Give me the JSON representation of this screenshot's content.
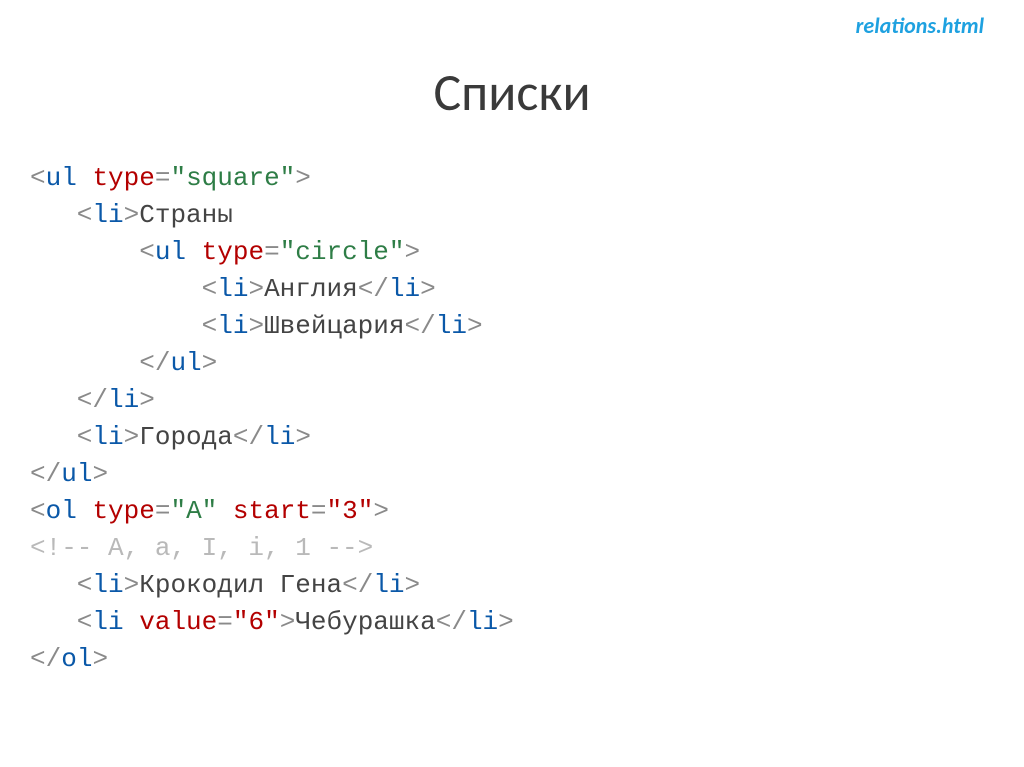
{
  "header": {
    "filelink": "relations.html",
    "title": "Списки"
  },
  "code": {
    "lines": [
      [
        {
          "cls": "p",
          "t": "<"
        },
        {
          "cls": "t",
          "t": "ul"
        },
        {
          "cls": "p",
          "t": " "
        },
        {
          "cls": "a",
          "t": "type"
        },
        {
          "cls": "p",
          "t": "="
        },
        {
          "cls": "v",
          "t": "\"square\""
        },
        {
          "cls": "p",
          "t": ">"
        }
      ],
      [
        {
          "cls": "p",
          "t": "   <"
        },
        {
          "cls": "t",
          "t": "li"
        },
        {
          "cls": "p",
          "t": ">"
        },
        {
          "cls": "tx",
          "t": "Страны"
        }
      ],
      [
        {
          "cls": "p",
          "t": "       <"
        },
        {
          "cls": "t",
          "t": "ul"
        },
        {
          "cls": "p",
          "t": " "
        },
        {
          "cls": "a",
          "t": "type"
        },
        {
          "cls": "p",
          "t": "="
        },
        {
          "cls": "v",
          "t": "\"circle\""
        },
        {
          "cls": "p",
          "t": ">"
        }
      ],
      [
        {
          "cls": "p",
          "t": "           <"
        },
        {
          "cls": "t",
          "t": "li"
        },
        {
          "cls": "p",
          "t": ">"
        },
        {
          "cls": "tx",
          "t": "Англия"
        },
        {
          "cls": "p",
          "t": "</"
        },
        {
          "cls": "t",
          "t": "li"
        },
        {
          "cls": "p",
          "t": ">"
        }
      ],
      [
        {
          "cls": "p",
          "t": "           <"
        },
        {
          "cls": "t",
          "t": "li"
        },
        {
          "cls": "p",
          "t": ">"
        },
        {
          "cls": "tx",
          "t": "Швейцария"
        },
        {
          "cls": "p",
          "t": "</"
        },
        {
          "cls": "t",
          "t": "li"
        },
        {
          "cls": "p",
          "t": ">"
        }
      ],
      [
        {
          "cls": "p",
          "t": "       </"
        },
        {
          "cls": "t",
          "t": "ul"
        },
        {
          "cls": "p",
          "t": ">"
        }
      ],
      [
        {
          "cls": "p",
          "t": "   </"
        },
        {
          "cls": "t",
          "t": "li"
        },
        {
          "cls": "p",
          "t": ">"
        }
      ],
      [
        {
          "cls": "p",
          "t": "   <"
        },
        {
          "cls": "t",
          "t": "li"
        },
        {
          "cls": "p",
          "t": ">"
        },
        {
          "cls": "tx",
          "t": "Города"
        },
        {
          "cls": "p",
          "t": "</"
        },
        {
          "cls": "t",
          "t": "li"
        },
        {
          "cls": "p",
          "t": ">"
        }
      ],
      [
        {
          "cls": "p",
          "t": "</"
        },
        {
          "cls": "t",
          "t": "ul"
        },
        {
          "cls": "p",
          "t": ">"
        }
      ],
      [
        {
          "cls": "p",
          "t": "<"
        },
        {
          "cls": "t",
          "t": "ol"
        },
        {
          "cls": "p",
          "t": " "
        },
        {
          "cls": "a",
          "t": "type"
        },
        {
          "cls": "p",
          "t": "="
        },
        {
          "cls": "v",
          "t": "\"A\""
        },
        {
          "cls": "p",
          "t": " "
        },
        {
          "cls": "a",
          "t": "start"
        },
        {
          "cls": "p",
          "t": "="
        },
        {
          "cls": "nv",
          "t": "\"3\""
        },
        {
          "cls": "p",
          "t": ">"
        }
      ],
      [
        {
          "cls": "c",
          "t": "<!-- A, a, I, i, 1 -->"
        }
      ],
      [
        {
          "cls": "p",
          "t": "   <"
        },
        {
          "cls": "t",
          "t": "li"
        },
        {
          "cls": "p",
          "t": ">"
        },
        {
          "cls": "tx",
          "t": "Крокодил Гена"
        },
        {
          "cls": "p",
          "t": "</"
        },
        {
          "cls": "t",
          "t": "li"
        },
        {
          "cls": "p",
          "t": ">"
        }
      ],
      [
        {
          "cls": "p",
          "t": "   <"
        },
        {
          "cls": "t",
          "t": "li"
        },
        {
          "cls": "p",
          "t": " "
        },
        {
          "cls": "a",
          "t": "value"
        },
        {
          "cls": "p",
          "t": "="
        },
        {
          "cls": "nv",
          "t": "\"6\""
        },
        {
          "cls": "p",
          "t": ">"
        },
        {
          "cls": "tx",
          "t": "Чебурашка"
        },
        {
          "cls": "p",
          "t": "</"
        },
        {
          "cls": "t",
          "t": "li"
        },
        {
          "cls": "p",
          "t": ">"
        }
      ],
      [
        {
          "cls": "p",
          "t": "</"
        },
        {
          "cls": "t",
          "t": "ol"
        },
        {
          "cls": "p",
          "t": ">"
        }
      ]
    ]
  }
}
